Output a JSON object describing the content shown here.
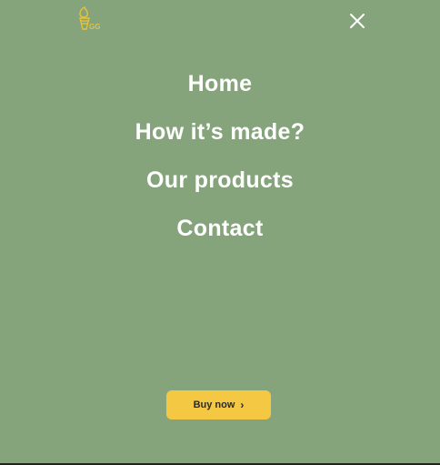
{
  "brand": {
    "logo_text": "GG",
    "accent": "#e5c23a"
  },
  "close": {
    "icon": "close-icon"
  },
  "nav": {
    "items": [
      {
        "label": "Home"
      },
      {
        "label": "How it’s made?"
      },
      {
        "label": "Our products"
      },
      {
        "label": "Contact"
      }
    ]
  },
  "cta": {
    "label": "Buy now",
    "icon": "chevron-right-icon",
    "color": "#f4c843"
  },
  "colors": {
    "background": "#86a47b",
    "text": "#ffffff"
  }
}
